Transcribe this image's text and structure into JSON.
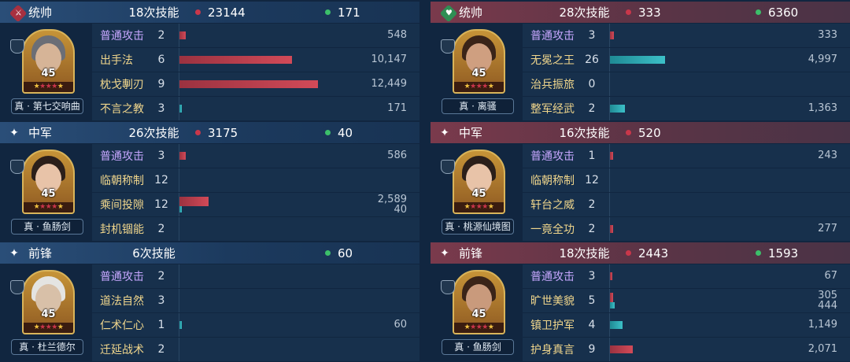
{
  "left": {
    "blocks": [
      {
        "role": "统帅",
        "icon": "sword-emblem-icon",
        "emblem": "red",
        "count": "18次技能",
        "damage": "23144",
        "heal": "171",
        "hero": {
          "name": "真 · 第七交响曲",
          "level": "45",
          "stars": 5,
          "red_stars": 3
        },
        "skills": [
          {
            "name": "普通攻击",
            "level": "2",
            "basic": true,
            "values": [
              "548"
            ],
            "bars": [
              {
                "color": "red",
                "fraction": 0.044
              }
            ]
          },
          {
            "name": "出手法",
            "level": "6",
            "values": [
              "10,147"
            ],
            "bars": [
              {
                "color": "red",
                "fraction": 0.815
              }
            ]
          },
          {
            "name": "枕戈剸刃",
            "level": "9",
            "values": [
              "12,449"
            ],
            "bars": [
              {
                "color": "red",
                "fraction": 1.0
              }
            ]
          },
          {
            "name": "不言之教",
            "level": "3",
            "values": [
              "171"
            ],
            "bars": [
              {
                "color": "teal",
                "fraction": 0.014
              }
            ]
          }
        ]
      },
      {
        "role": "中军",
        "icon": "sparkle-icon",
        "count": "26次技能",
        "damage": "3175",
        "heal": "40",
        "hero": {
          "name": "真 · 鱼肠剑",
          "level": "45",
          "stars": 5,
          "red_stars": 3
        },
        "skills": [
          {
            "name": "普通攻击",
            "level": "3",
            "basic": true,
            "values": [
              "586"
            ],
            "bars": [
              {
                "color": "red",
                "fraction": 0.047
              }
            ]
          },
          {
            "name": "临朝称制",
            "level": "12",
            "values": [],
            "bars": []
          },
          {
            "name": "乘间投隙",
            "level": "12",
            "values": [
              "2,589",
              "40"
            ],
            "bars": [
              {
                "color": "red",
                "fraction": 0.208
              },
              {
                "color": "teal",
                "fraction": 0.004
              }
            ]
          },
          {
            "name": "封机锢能",
            "level": "2",
            "values": [],
            "bars": []
          }
        ]
      },
      {
        "role": "前锋",
        "icon": "sparkle-icon",
        "count": "6次技能",
        "damage": "",
        "heal": "60",
        "hero": {
          "name": "真 · 杜兰德尔",
          "level": "45",
          "stars": 5,
          "red_stars": 3
        },
        "skills": [
          {
            "name": "普通攻击",
            "level": "2",
            "basic": true,
            "values": [],
            "bars": []
          },
          {
            "name": "道法自然",
            "level": "3",
            "values": [],
            "bars": []
          },
          {
            "name": "仁术仁心",
            "level": "1",
            "values": [
              "60"
            ],
            "bars": [
              {
                "color": "teal",
                "fraction": 0.005
              }
            ]
          },
          {
            "name": "迁延战术",
            "level": "2",
            "values": [],
            "bars": []
          }
        ]
      }
    ]
  },
  "right": {
    "blocks": [
      {
        "role": "统帅",
        "icon": "heart-emblem-icon",
        "emblem": "green",
        "count": "28次技能",
        "damage": "333",
        "heal": "6360",
        "hero": {
          "name": "真 · 离骚",
          "level": "45",
          "stars": 5,
          "red_stars": 3
        },
        "skills": [
          {
            "name": "普通攻击",
            "level": "3",
            "basic": true,
            "values": [
              "333"
            ],
            "bars": [
              {
                "color": "red",
                "fraction": 0.027
              }
            ]
          },
          {
            "name": "无冕之王",
            "level": "26",
            "values": [
              "4,997"
            ],
            "bars": [
              {
                "color": "teal",
                "fraction": 0.4
              }
            ]
          },
          {
            "name": "治兵振旅",
            "level": "0",
            "values": [],
            "bars": []
          },
          {
            "name": "整军经武",
            "level": "2",
            "values": [
              "1,363"
            ],
            "bars": [
              {
                "color": "teal",
                "fraction": 0.11
              }
            ]
          }
        ]
      },
      {
        "role": "中军",
        "icon": "sparkle-icon",
        "count": "16次技能",
        "damage": "520",
        "heal": "",
        "hero": {
          "name": "真 · 桃源仙境图",
          "level": "45",
          "stars": 5,
          "red_stars": 3
        },
        "skills": [
          {
            "name": "普通攻击",
            "level": "1",
            "basic": true,
            "values": [
              "243"
            ],
            "bars": [
              {
                "color": "red",
                "fraction": 0.02
              }
            ]
          },
          {
            "name": "临朝称制",
            "level": "12",
            "values": [],
            "bars": []
          },
          {
            "name": "轩台之威",
            "level": "2",
            "values": [],
            "bars": []
          },
          {
            "name": "一竟全功",
            "level": "2",
            "values": [
              "277"
            ],
            "bars": [
              {
                "color": "red",
                "fraction": 0.022
              }
            ]
          }
        ]
      },
      {
        "role": "前锋",
        "icon": "sparkle-icon",
        "count": "18次技能",
        "damage": "2443",
        "heal": "1593",
        "hero": {
          "name": "真 · 鱼肠剑",
          "level": "45",
          "stars": 5,
          "red_stars": 3
        },
        "skills": [
          {
            "name": "普通攻击",
            "level": "3",
            "basic": true,
            "values": [
              "67"
            ],
            "bars": [
              {
                "color": "red",
                "fraction": 0.006
              }
            ]
          },
          {
            "name": "旷世美貌",
            "level": "5",
            "values": [
              "305",
              "444"
            ],
            "bars": [
              {
                "color": "red",
                "fraction": 0.025
              },
              {
                "color": "teal",
                "fraction": 0.036
              }
            ]
          },
          {
            "name": "镇卫护军",
            "level": "4",
            "values": [
              "1,149"
            ],
            "bars": [
              {
                "color": "teal",
                "fraction": 0.092
              }
            ]
          },
          {
            "name": "护身真言",
            "level": "9",
            "values": [
              "2,071"
            ],
            "bars": [
              {
                "color": "red",
                "fraction": 0.166
              }
            ]
          }
        ]
      }
    ]
  },
  "colors": {
    "damage_dot": "#c9374a",
    "heal_dot": "#3cbf6a",
    "damage_bar": "#d24a58",
    "heal_bar": "#3cc0c8",
    "skill_name": "#f0d68c",
    "basic_attack": "#c7a7ff"
  }
}
